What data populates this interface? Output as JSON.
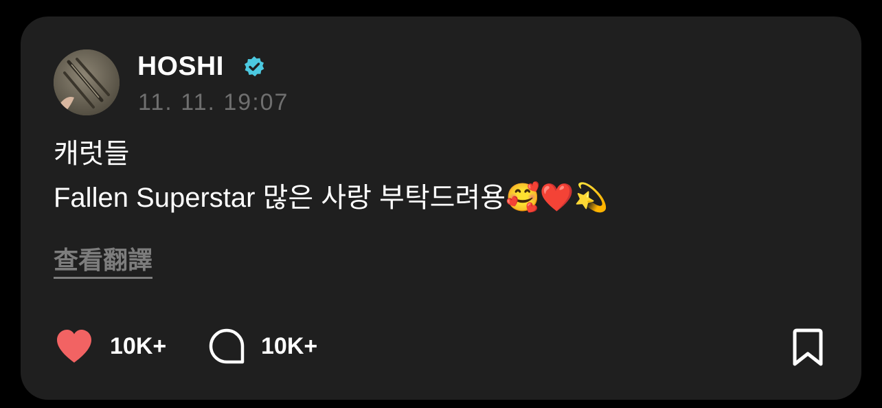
{
  "post": {
    "author": {
      "name": "HOSHI",
      "verified": true,
      "avatar_icon": "avatar-photo-icon"
    },
    "timestamp": "11. 11. 19:07",
    "lines": [
      "캐럿들",
      "Fallen Superstar 많은 사랑 부탁드려용🥰❤️💫"
    ],
    "translate_label": "查看翻譯"
  },
  "actions": {
    "like": {
      "icon": "heart-icon",
      "count": "10K+",
      "color": "#f26363"
    },
    "comment": {
      "icon": "comment-bubble-icon",
      "count": "10K+"
    },
    "bookmark": {
      "icon": "bookmark-icon"
    }
  },
  "colors": {
    "background": "#000000",
    "card": "#1f1f1f",
    "text": "#ffffff",
    "muted": "#6f6f6f",
    "verified_badge": "#4cc9e0",
    "like": "#f26363"
  }
}
